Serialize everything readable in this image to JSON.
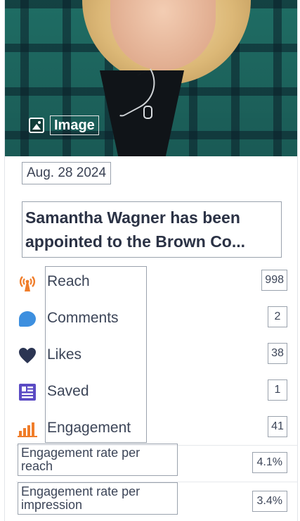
{
  "photo": {
    "badge_label": "Image"
  },
  "post": {
    "date": "Aug. 28 2024",
    "title_line1": "Samantha Wagner has been",
    "title_line2": "appointed to the Brown Co..."
  },
  "metrics": [
    {
      "label": "Reach",
      "value": "998",
      "icon": "broadcast-icon",
      "color": "#f07d2a"
    },
    {
      "label": "Comments",
      "value": "2",
      "icon": "speech-bubble-icon",
      "color": "#3d8fdf"
    },
    {
      "label": "Likes",
      "value": "38",
      "icon": "heart-icon",
      "color": "#2b3553"
    },
    {
      "label": "Saved",
      "value": "1",
      "icon": "saved-icon",
      "color": "#5b4bc4"
    },
    {
      "label": "Engagement",
      "value": "41",
      "icon": "bar-chart-icon",
      "color": "#f07d2a"
    }
  ],
  "rates": [
    {
      "label_line1": "Engagement rate per",
      "label_line2": "reach",
      "value": "4.1%"
    },
    {
      "label_line1": "Engagement rate per",
      "label_line2": "impression",
      "value": "3.4%"
    }
  ]
}
